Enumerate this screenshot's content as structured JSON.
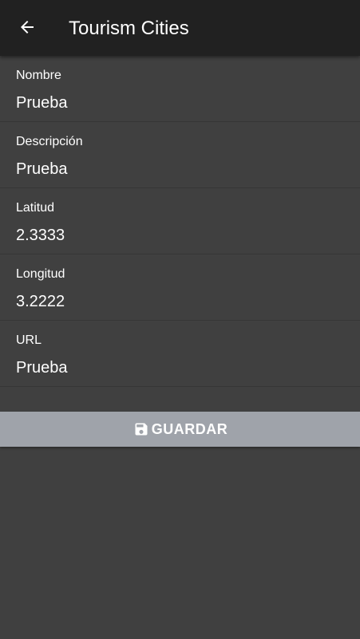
{
  "toolbar": {
    "back_icon": "arrow-left-icon",
    "title": "Tourism Cities"
  },
  "form": {
    "fields": [
      {
        "label": "Nombre",
        "value": "Prueba"
      },
      {
        "label": "Descripción",
        "value": "Prueba"
      },
      {
        "label": "Latitud",
        "value": "2.3333"
      },
      {
        "label": "Longitud",
        "value": "3.2222"
      },
      {
        "label": "URL",
        "value": "Prueba"
      }
    ]
  },
  "save_button": {
    "icon": "save-icon",
    "label": "GUARDAR"
  },
  "colors": {
    "toolbar": "#212121",
    "background": "#404040",
    "button": "#9fa3aa",
    "text": "#ffffff"
  }
}
